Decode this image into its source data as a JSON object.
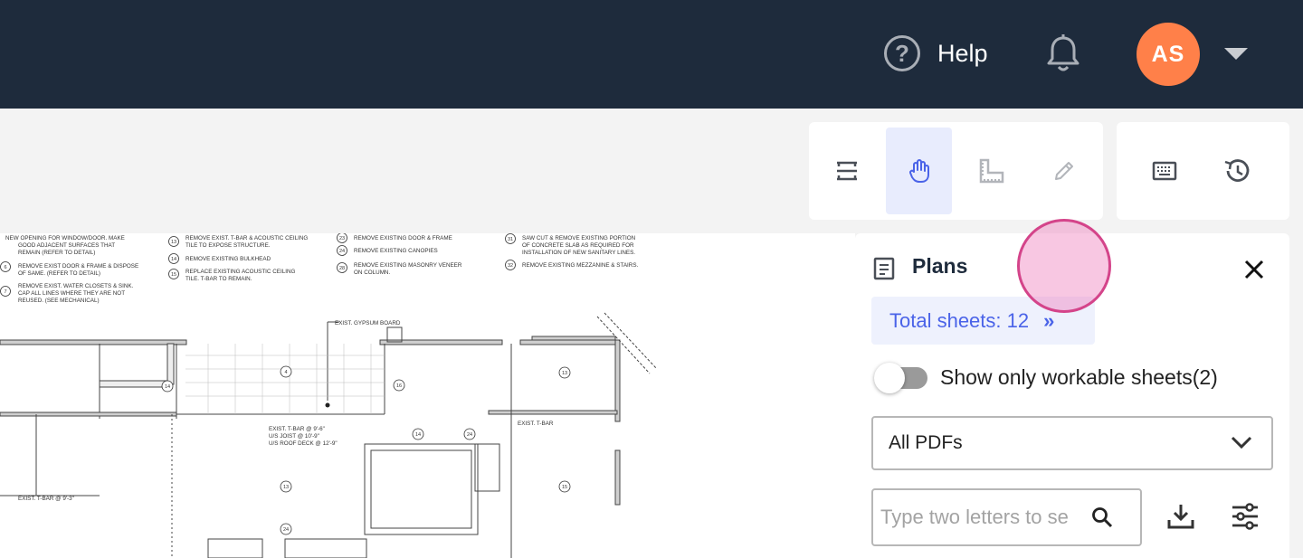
{
  "header": {
    "help_label": "Help",
    "help_glyph": "?",
    "avatar_initials": "AS",
    "colors": {
      "bar": "#1e2b3c",
      "avatar": "#ff8049"
    },
    "icons": [
      "help-circle-icon",
      "bell-icon",
      "chevron-down-icon"
    ]
  },
  "toolbar": {
    "tools": [
      {
        "name": "split-view-icon",
        "active": false
      },
      {
        "name": "hand-pan-icon",
        "active": true
      },
      {
        "name": "measure-area-icon",
        "active": false
      },
      {
        "name": "pencil-markup-icon",
        "active": false
      }
    ],
    "secondary": [
      "keyboard-icon",
      "history-icon"
    ]
  },
  "drawing": {
    "notes": [
      [
        "NEW OPENING FOR WINDOW/DOOR. MAKE",
        "GOOD ADJACENT SURFACES THAT",
        "REMAIN (REFER TO DETAIL)"
      ],
      [
        "REMOVE EXIST DOOR & FRAME & DISPOSE",
        "OF SAME.  (REFER TO DETAIL)"
      ],
      [
        "REMOVE EXIST. WATER CLOSETS & SINK.",
        "CAP ALL LINES WHERE THEY ARE NOT",
        "REUSED. (SEE MECHANICAL)"
      ],
      [
        "REMOVE EXIST. T-BAR & ACOUSTIC CEILING",
        "TILE TO EXPOSE STRUCTURE."
      ],
      [
        "REMOVE EXISTING BULKHEAD"
      ],
      [
        "REPLACE EXISTING ACOUSTIC CEILING",
        "TILE. T-BAR TO REMAIN."
      ],
      [
        "REMOVE EXISTING DOOR & FRAME"
      ],
      [
        "REMOVE EXISTING CANOPIES"
      ],
      [
        "REMOVE EXISTING MASONRY VENEER",
        "ON COLUMN."
      ],
      [
        "SAW CUT & REMOVE EXISTING PORTION",
        "OF CONCRETE SLAB AS REQUIRED FOR",
        "INSTALLATION OF NEW SANITARY LINES."
      ],
      [
        "REMOVE EXISTING MEZZANINE & STAIRS."
      ]
    ],
    "note_numbers": [
      "6",
      "7",
      "13",
      "14",
      "15",
      "23",
      "24",
      "28",
      "31",
      "32"
    ],
    "plan_labels": {
      "gypsum": "EXIST. GYPSUM BOARD",
      "tbar_main": [
        "EXIST. T-BAR @ 9'-6\"",
        "U/S JOIST @ 10'-9\"",
        "U/S ROOF DECK @ 12'-9\""
      ],
      "tbar_right": "EXIST. T-BAR",
      "tbar_left": "EXIST. T-BAR @ 9'-3\""
    },
    "tags": [
      "4",
      "16",
      "14",
      "13",
      "14",
      "24",
      "13",
      "15",
      "24",
      "24"
    ]
  },
  "plans_panel": {
    "title": "Plans",
    "total_sheets": "Total sheets: 12",
    "total_chevron": "»",
    "toggle_label": "Show only workable sheets(2)",
    "toggle_on": false,
    "filter_selected": "All PDFs",
    "search_placeholder": "Type two letters to search",
    "icons": [
      "document-icon",
      "close-icon",
      "search-icon",
      "download-icon",
      "filter-sliders-icon"
    ],
    "accent": "#4a63e8"
  }
}
